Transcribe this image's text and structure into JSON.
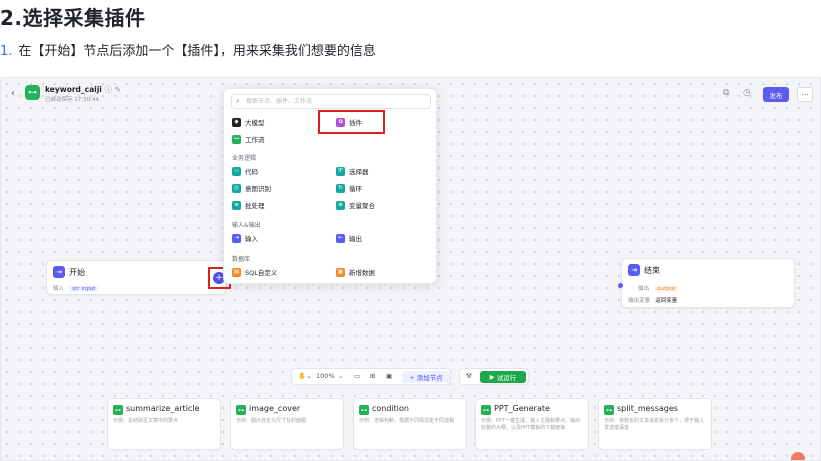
{
  "doc": {
    "title": "2.选择采集插件",
    "step_number": "1.",
    "step_text": "在【开始】节点后添加一个【插件】，用来采集我们想要的信息"
  },
  "app": {
    "name": "keyword_caiji",
    "save_status": "已自动保存 17:30:44",
    "publish_label": "发布"
  },
  "popup": {
    "search_placeholder": "搜索节点、插件、工作流",
    "top_items": [
      {
        "label": "大模型",
        "icon": "llm-icon",
        "color": "#1f2329"
      },
      {
        "label": "插件",
        "icon": "plugin-icon",
        "color": "#b44fd9"
      },
      {
        "label": "工作流",
        "icon": "workflow-icon",
        "color": "#27b05a"
      }
    ],
    "section_logic": "业务逻辑",
    "logic_items": [
      {
        "label": "代码",
        "icon": "code-icon",
        "color": "#14a9a0"
      },
      {
        "label": "选择器",
        "icon": "selector-icon",
        "color": "#14a9a0"
      },
      {
        "label": "意图识别",
        "icon": "intent-icon",
        "color": "#14a9a0"
      },
      {
        "label": "循环",
        "icon": "loop-icon",
        "color": "#14a9a0"
      },
      {
        "label": "批处理",
        "icon": "batch-icon",
        "color": "#14a9a0"
      },
      {
        "label": "变量聚合",
        "icon": "variable-icon",
        "color": "#14a9a0"
      }
    ],
    "section_io": "输入&输出",
    "io_items": [
      {
        "label": "输入",
        "icon": "input-icon",
        "color": "#5a5cf0"
      },
      {
        "label": "输出",
        "icon": "output-icon",
        "color": "#5a5cf0"
      }
    ],
    "section_db": "数据库",
    "db_items": [
      {
        "label": "SQL自定义",
        "icon": "sql-icon",
        "color": "#f08a24"
      },
      {
        "label": "新增数据",
        "icon": "add-data-icon",
        "color": "#f08a24"
      }
    ]
  },
  "start_node": {
    "title": "开始",
    "input_label": "输入",
    "input_tag": "input"
  },
  "end_node": {
    "title": "结束",
    "output_label": "输出",
    "output_tag": "output",
    "output_var_label": "输出变量",
    "output_var_value": "返回变量"
  },
  "toolbar": {
    "zoom": "100%",
    "add_node_label": "+ 添加节点",
    "run_label": "试运行"
  },
  "templates": [
    {
      "name": "summarize_article",
      "desc": "示例：总结网页文章中的要点"
    },
    {
      "name": "image_cover",
      "desc": "示例：图片自定义尺寸及封面图"
    },
    {
      "name": "condition",
      "desc": "示例：逻辑判断，根据不同情况走不同流程"
    },
    {
      "name": "PPT_Generate",
      "desc": "示例：PPT一键生成，输入主题和要点，输出完整的大纲，以及PPT模板的下载链接"
    },
    {
      "name": "split_messages",
      "desc": "示例：将较长的文本消息拆分多个，便于输入发送或语音"
    }
  ],
  "colors": {
    "accent": "#5a5cf0",
    "highlight_box": "#e02020",
    "run_green": "#1fa74b"
  }
}
